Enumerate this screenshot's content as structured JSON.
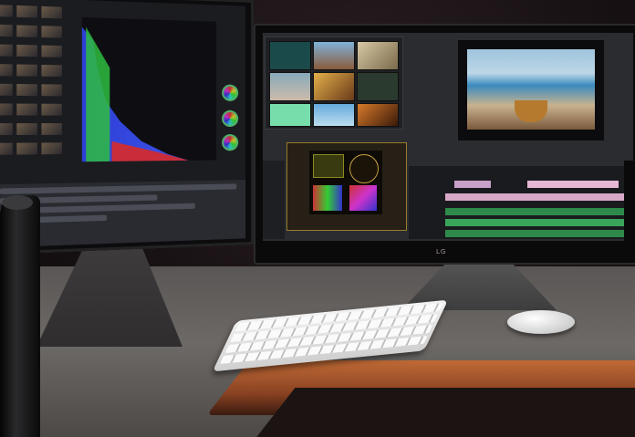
{
  "scene": {
    "description_free": true
  },
  "right_monitor": {
    "brand_text": "LG"
  },
  "colors": {
    "histogram_blue": "#2b3fd6",
    "histogram_green": "#2fbd3f",
    "histogram_red": "#c92d3a",
    "desk_trim": "#c06a36",
    "scope_border": "#9a7c2a"
  },
  "icons": [
    "histogram",
    "color-wheel",
    "vectorscope",
    "waveform"
  ]
}
